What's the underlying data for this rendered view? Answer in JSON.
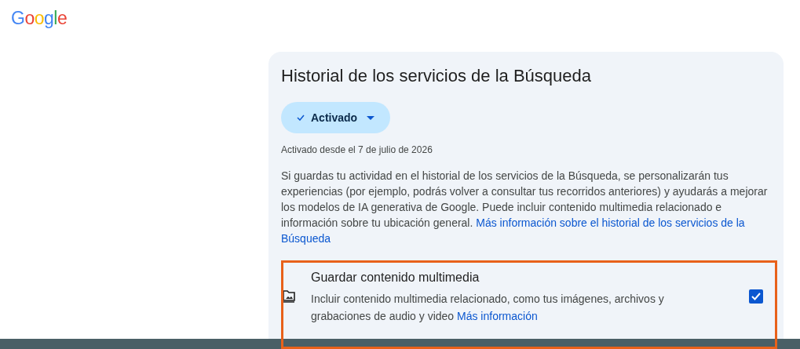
{
  "logo": "Google",
  "section": {
    "title": "Historial de los servicios de la Búsqueda",
    "status_button": {
      "label": "Activado",
      "on": true
    },
    "since": "Activado desde el 7 de julio de 2026",
    "description": "Si guardas tu actividad en el historial de los servicios de la Búsqueda, se personalizarán tus experiencias (por ejemplo, podrás volver a consultar tus recorridos anteriores) y ayudarás a mejorar los modelos de IA generativa de Google. Puede incluir contenido multimedia relacionado e información sobre tu ubicación general.",
    "link_lines": [
      "Más información sobre el historial de los servicios de la",
      "Búsqueda"
    ],
    "setting": {
      "title": "Guardar contenido multimedia",
      "description": "Incluir contenido multimedia relacionado, como tus imágenes, archivos y grabaciones de audio y video",
      "link": "Más información",
      "checked": true,
      "highlighted": true
    }
  }
}
